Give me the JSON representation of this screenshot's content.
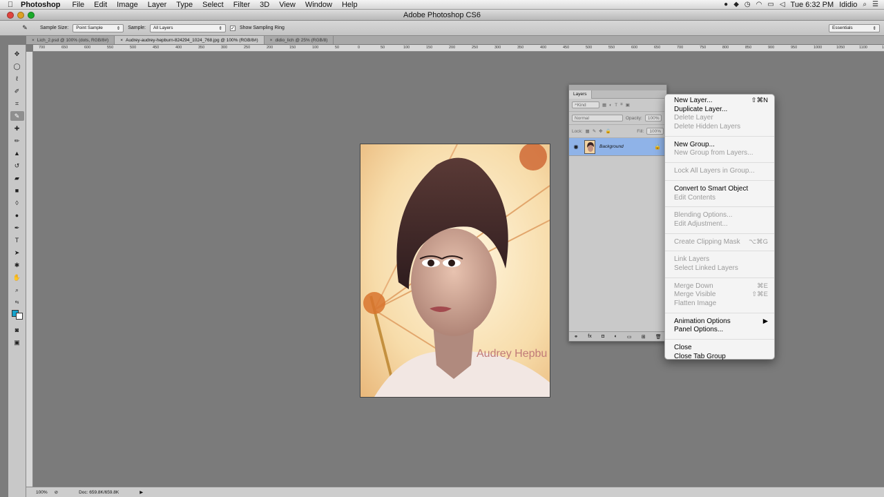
{
  "menubar": {
    "app_name": "Photoshop",
    "items": [
      "File",
      "Edit",
      "Image",
      "Layer",
      "Type",
      "Select",
      "Filter",
      "3D",
      "View",
      "Window",
      "Help"
    ],
    "clock": "Tue 6:32 PM",
    "user": "Ididio"
  },
  "window": {
    "title": "Adobe Photoshop CS6"
  },
  "options": {
    "sample_size_label": "Sample Size:",
    "sample_size_value": "Point Sample",
    "sample_label": "Sample:",
    "sample_value": "All Layers",
    "show_ring_label": "Show Sampling Ring",
    "workspace": "Essentials"
  },
  "tabs": [
    {
      "label": "Lich_2.psd @ 100% (dots, RGB/8#)"
    },
    {
      "label": "Audrey-audrey-hepburn-824294_1024_768.jpg @ 100% (RGB/8#)"
    },
    {
      "label": "didio_lich @ 25% (RGB/8)"
    }
  ],
  "ruler_ticks": [
    "700",
    "650",
    "600",
    "550",
    "500",
    "450",
    "400",
    "350",
    "300",
    "250",
    "200",
    "150",
    "100",
    "50",
    "0",
    "50",
    "100",
    "150",
    "200",
    "250",
    "300",
    "350",
    "400",
    "450",
    "500",
    "550",
    "600",
    "650",
    "700",
    "750",
    "800",
    "850",
    "900",
    "950",
    "1000",
    "1050",
    "1100",
    "1150"
  ],
  "image": {
    "watermark": "Audrey Hepbu"
  },
  "status": {
    "zoom": "100%",
    "doc": "Doc: 659.8K/659.8K"
  },
  "layers_panel": {
    "tab": "Layers",
    "kind": "Kind",
    "blend_mode": "Normal",
    "opacity_label": "Opacity:",
    "opacity_value": "100%",
    "lock_label": "Lock:",
    "fill_label": "Fill:",
    "fill_value": "100%",
    "layer_name": "Background"
  },
  "panel_menu": {
    "new_layer": "New Layer...",
    "new_layer_sc": "⇧⌘N",
    "duplicate_layer": "Duplicate Layer...",
    "delete_layer": "Delete Layer",
    "delete_hidden": "Delete Hidden Layers",
    "new_group": "New Group...",
    "new_group_from": "New Group from Layers...",
    "lock_all": "Lock All Layers in Group...",
    "convert_smart": "Convert to Smart Object",
    "edit_contents": "Edit Contents",
    "blending_options": "Blending Options...",
    "edit_adjustment": "Edit Adjustment...",
    "clipping_mask": "Create Clipping Mask",
    "clipping_mask_sc": "⌥⌘G",
    "link_layers": "Link Layers",
    "select_linked": "Select Linked Layers",
    "merge_down": "Merge Down",
    "merge_down_sc": "⌘E",
    "merge_visible": "Merge Visible",
    "merge_visible_sc": "⇧⌘E",
    "flatten": "Flatten Image",
    "animation_options": "Animation Options",
    "panel_options": "Panel Options...",
    "close": "Close",
    "close_tab_group": "Close Tab Group"
  }
}
